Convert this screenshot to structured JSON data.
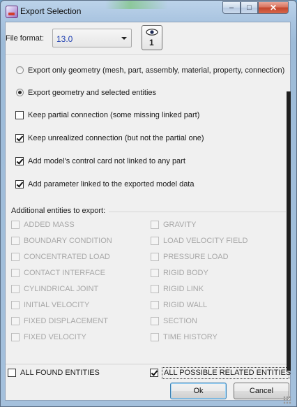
{
  "window": {
    "title": "Export Selection",
    "controls": {
      "minimize": "–",
      "maximize": "□",
      "close": "✕"
    }
  },
  "file_format": {
    "label": "File format:",
    "value": "13.0",
    "view_button_label": "1",
    "view_icon": "eye-icon"
  },
  "export_mode": [
    {
      "label": "Export only geometry (mesh, part, assembly, material, property, connection)",
      "selected": false
    },
    {
      "label": "Export geometry and selected entities",
      "selected": true
    }
  ],
  "options": [
    {
      "label": "Keep partial connection (some missing linked part)",
      "checked": false
    },
    {
      "label": "Keep unrealized connection (but not the partial one)",
      "checked": true
    },
    {
      "label": "Add model's control card not linked to any part",
      "checked": true
    },
    {
      "label": "Add parameter linked to the exported model data",
      "checked": true
    }
  ],
  "additional": {
    "title": "Additional entities to export:",
    "left": [
      "ADDED MASS",
      "BOUNDARY CONDITION",
      "CONCENTRATED LOAD",
      "CONTACT INTERFACE",
      "CYLINDRICAL JOINT",
      "INITIAL VELOCITY",
      "FIXED DISPLACEMENT",
      "FIXED VELOCITY"
    ],
    "right": [
      "GRAVITY",
      "LOAD VELOCITY FIELD",
      "PRESSURE LOAD",
      "RIGID BODY",
      "RIGID LINK",
      "RIGID WALL",
      "SECTION",
      "TIME HISTORY"
    ]
  },
  "all_found": {
    "label": "ALL FOUND ENTITIES",
    "checked": false
  },
  "all_possible": {
    "label": "ALL POSSIBLE RELATED ENTITIES",
    "checked": true
  },
  "buttons": {
    "ok": "Ok",
    "cancel": "Cancel"
  }
}
